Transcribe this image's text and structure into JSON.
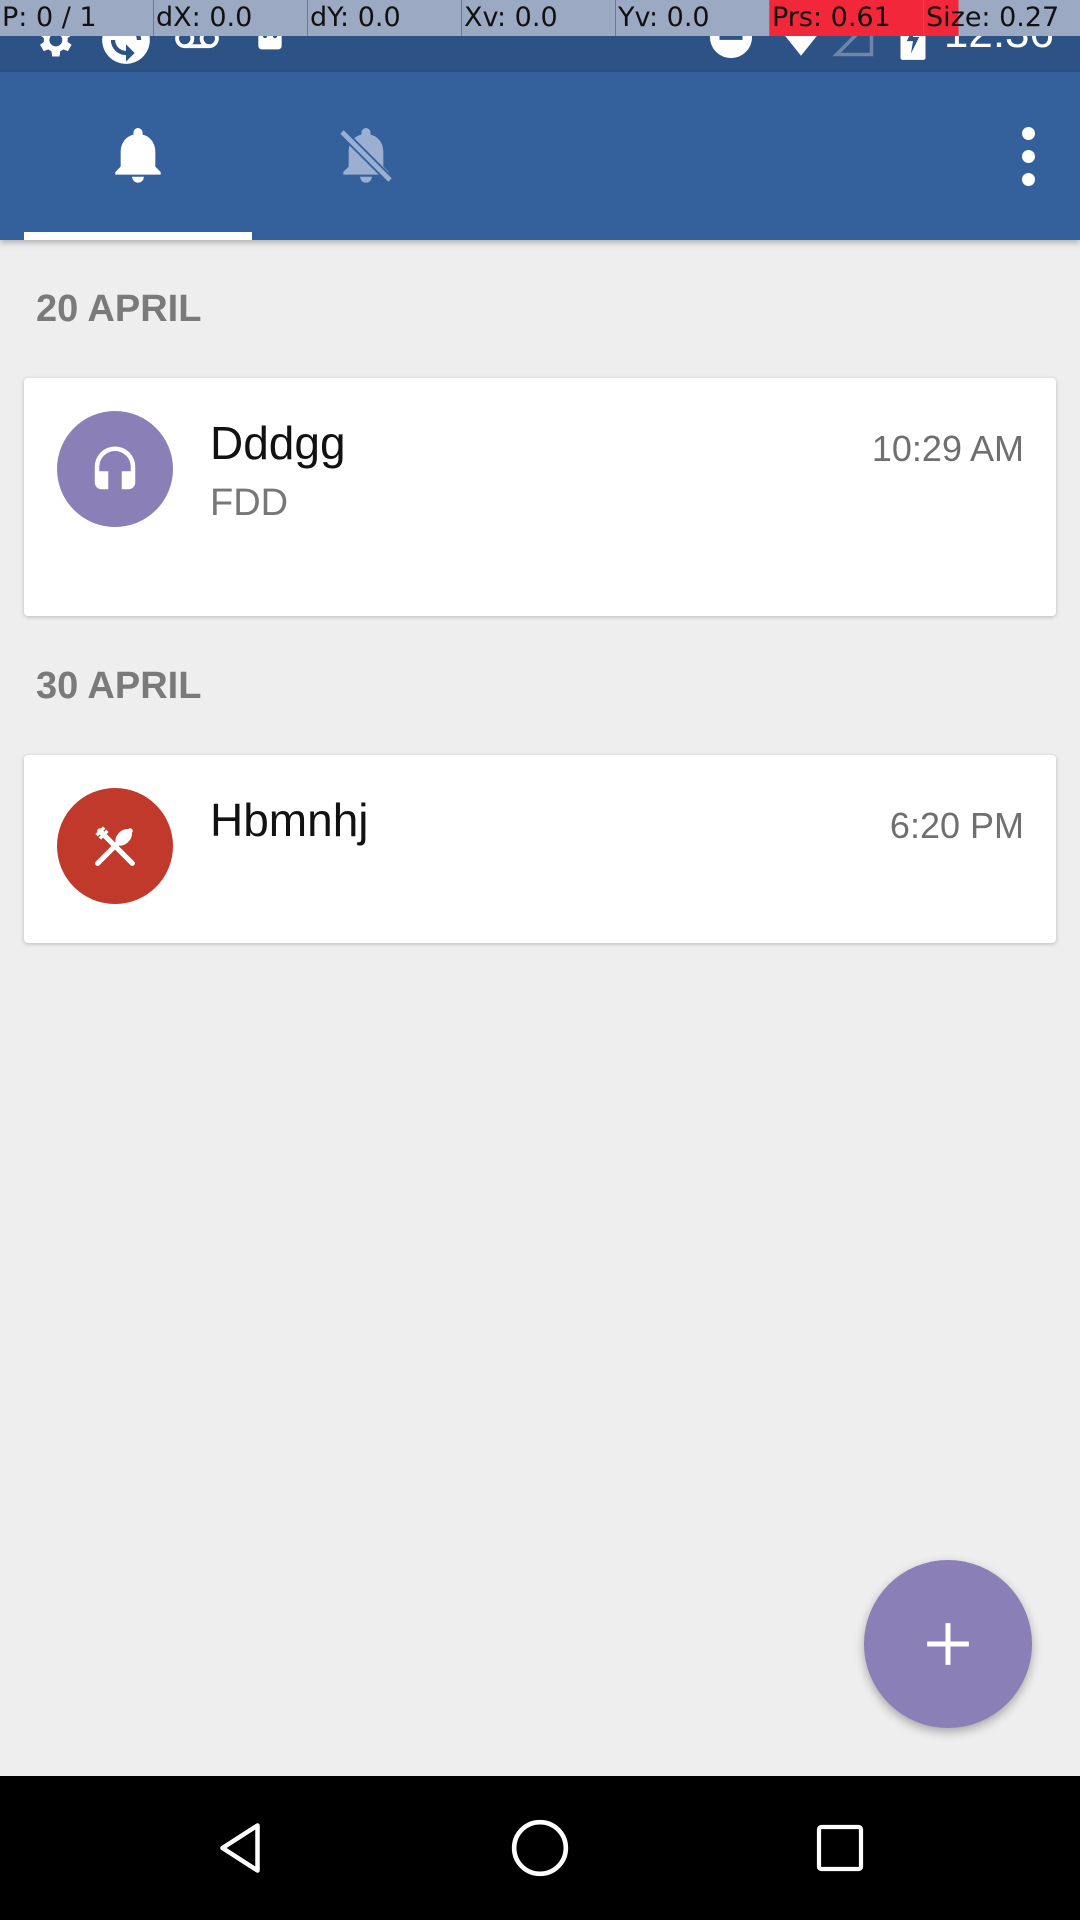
{
  "status_bar": {
    "time": "12:36",
    "debug": {
      "pointer": "P: 0 / 1",
      "dx": "dX: 0.0",
      "dy": "dY: 0.0",
      "xv": "Xv: 0.0",
      "yv": "Yv: 0.0",
      "prs": "Prs: 0.61",
      "size": "Size: 0.27"
    },
    "icons": [
      "settings-icon",
      "sync-icon",
      "voicemail-icon",
      "android-icon",
      "do-not-disturb-icon",
      "wifi-icon",
      "signal-icon",
      "battery-charging-icon"
    ]
  },
  "app_bar": {
    "tabs": [
      {
        "name": "notifications-active",
        "icon": "bell-icon",
        "selected": true
      },
      {
        "name": "notifications-off",
        "icon": "bell-off-icon",
        "selected": false
      }
    ],
    "overflow_icon": "more-vert-icon"
  },
  "sections": [
    {
      "header": "20 APRIL",
      "items": [
        {
          "title": "Dddgg",
          "subtitle": "FDD",
          "time": "10:29 AM",
          "icon": "headphones-icon",
          "color": "#8a7fb6"
        }
      ]
    },
    {
      "header": "30 APRIL",
      "items": [
        {
          "title": "Hbmnhj",
          "subtitle": "",
          "time": "6:20 PM",
          "icon": "restaurant-icon",
          "color": "#c0392b"
        }
      ]
    }
  ],
  "fab": {
    "icon": "plus-icon",
    "color": "#8a7fb6"
  },
  "nav_bar": {
    "icons": [
      "back-icon",
      "home-icon",
      "recents-icon"
    ]
  },
  "colors": {
    "primary": "#34619b",
    "status_bar": "#2c5286",
    "background": "#eeeeee"
  }
}
